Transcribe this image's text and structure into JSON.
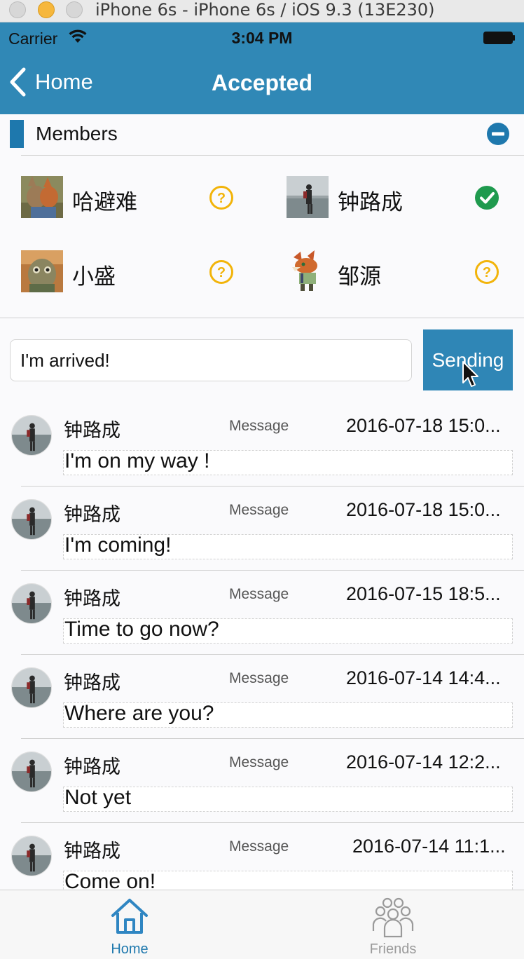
{
  "window": {
    "title": "iPhone 6s - iPhone 6s / iOS 9.3 (13E230)"
  },
  "status_bar": {
    "carrier": "Carrier",
    "time": "3:04 PM"
  },
  "nav": {
    "back_label": "Home",
    "title": "Accepted"
  },
  "members": {
    "title": "Members",
    "list": [
      {
        "name": "哈避难",
        "status": "pending"
      },
      {
        "name": "钟路成",
        "status": "accepted"
      },
      {
        "name": "小盛",
        "status": "pending"
      },
      {
        "name": "邹源",
        "status": "pending"
      }
    ]
  },
  "composer": {
    "input_value": "I'm arrived!",
    "send_label": "Sending"
  },
  "messages": [
    {
      "sender": "钟路成",
      "type": "Message",
      "time": "2016-07-18 15:0...",
      "text": "I'm on my way !"
    },
    {
      "sender": "钟路成",
      "type": "Message",
      "time": "2016-07-18 15:0...",
      "text": "I'm coming!"
    },
    {
      "sender": "钟路成",
      "type": "Message",
      "time": "2016-07-15 18:5...",
      "text": "Time to go now?"
    },
    {
      "sender": "钟路成",
      "type": "Message",
      "time": "2016-07-14 14:4...",
      "text": "Where are you?"
    },
    {
      "sender": "钟路成",
      "type": "Message",
      "time": "2016-07-14 12:2...",
      "text": "Not yet"
    },
    {
      "sender": "钟路成",
      "type": "Message",
      "time": "2016-07-14 11:1...",
      "text": "Come on!"
    }
  ],
  "tabbar": {
    "home_label": "Home",
    "friends_label": "Friends"
  },
  "colors": {
    "nav": "#3088b6",
    "accent": "#1e78ad",
    "pending": "#f2b40a",
    "accepted": "#1f9a4e",
    "tab_inactive": "#9a9a9a"
  }
}
